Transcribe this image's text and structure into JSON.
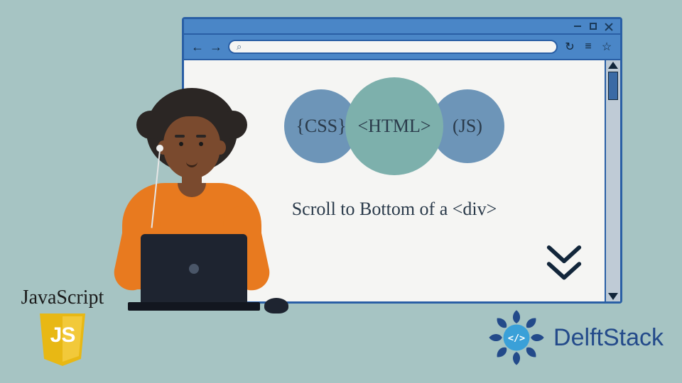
{
  "browser": {
    "toolbar": {
      "back": "←",
      "forward": "→",
      "search_glyph": "⌕",
      "reload": "↻",
      "menu": "≡",
      "star": "☆"
    }
  },
  "circles": {
    "css": "{CSS}",
    "html": "<HTML>",
    "js": "(JS)"
  },
  "caption": "Scroll to Bottom of a <div>",
  "js_badge": {
    "label": "JavaScript",
    "initials": "JS"
  },
  "brand": {
    "name": "DelftStack"
  }
}
